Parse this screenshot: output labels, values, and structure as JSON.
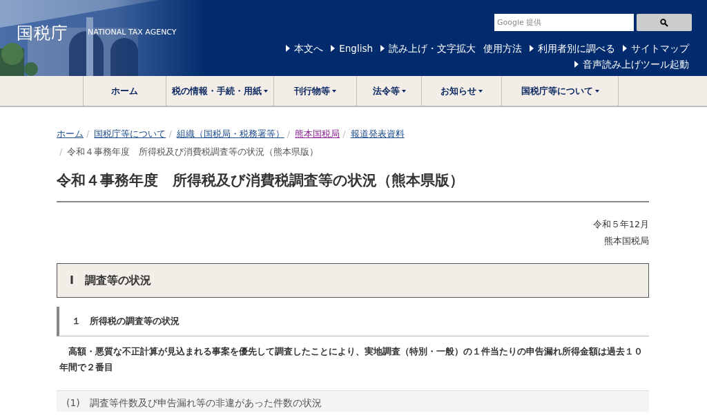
{
  "header": {
    "logo": "国税庁",
    "subtitle": "NATIONAL TAX AGENCY",
    "search": {
      "placeholder": "Google 提供"
    },
    "links": [
      [
        {
          "label": "本文へ",
          "arrow": true
        },
        {
          "label": "English",
          "arrow": true
        },
        {
          "label": "読み上げ・文字拡大",
          "arrow": true
        },
        {
          "label": "使用方法",
          "arrow": false
        },
        {
          "label": "利用者別に調べる",
          "arrow": true
        },
        {
          "label": "サイトマップ",
          "arrow": true
        }
      ],
      [
        {
          "label": "音声読み上げツール起動",
          "arrow": true
        }
      ]
    ]
  },
  "nav": [
    {
      "label": "ホーム",
      "dropdown": false
    },
    {
      "label": "税の情報・手続・用紙",
      "dropdown": true
    },
    {
      "label": "刊行物等",
      "dropdown": true
    },
    {
      "label": "法令等",
      "dropdown": true
    },
    {
      "label": "お知らせ",
      "dropdown": true
    },
    {
      "label": "国税庁等について",
      "dropdown": true
    }
  ],
  "breadcrumb": [
    {
      "label": "ホーム",
      "visited": false,
      "current": false
    },
    {
      "separator": "/",
      "label": "国税庁等について",
      "visited": false,
      "current": false
    },
    {
      "separator": "/",
      "label": "組織（国税局・税務署等）",
      "visited": false,
      "current": false
    },
    {
      "separator": "/",
      "label": "熊本国税局",
      "visited": true,
      "current": false
    },
    {
      "separator": "/",
      "label": "報道発表資料",
      "visited": false,
      "current": false
    },
    {
      "separator": "/",
      "label": "令和４事務年度　所得税及び消費税調査等の状況（熊本県版）",
      "current": true
    }
  ],
  "title": "令和４事務年度　所得税及び消費税調査等の状況（熊本県版）",
  "date": "令和５年12月",
  "issuer": "熊本国税局",
  "section": "Ⅰ　調査等の状況",
  "subsection": "１　所得税の調査等の状況",
  "summary": "高額・悪質な不正計算が見込まれる事案を優先して調査したことにより、実地調査（特別・一般）の１件当たりの申告漏れ所得金額は過去１０年間で２番目",
  "subsubsection": "(1)　調査等件数及び申告漏れ等の非違があった件数の状況"
}
